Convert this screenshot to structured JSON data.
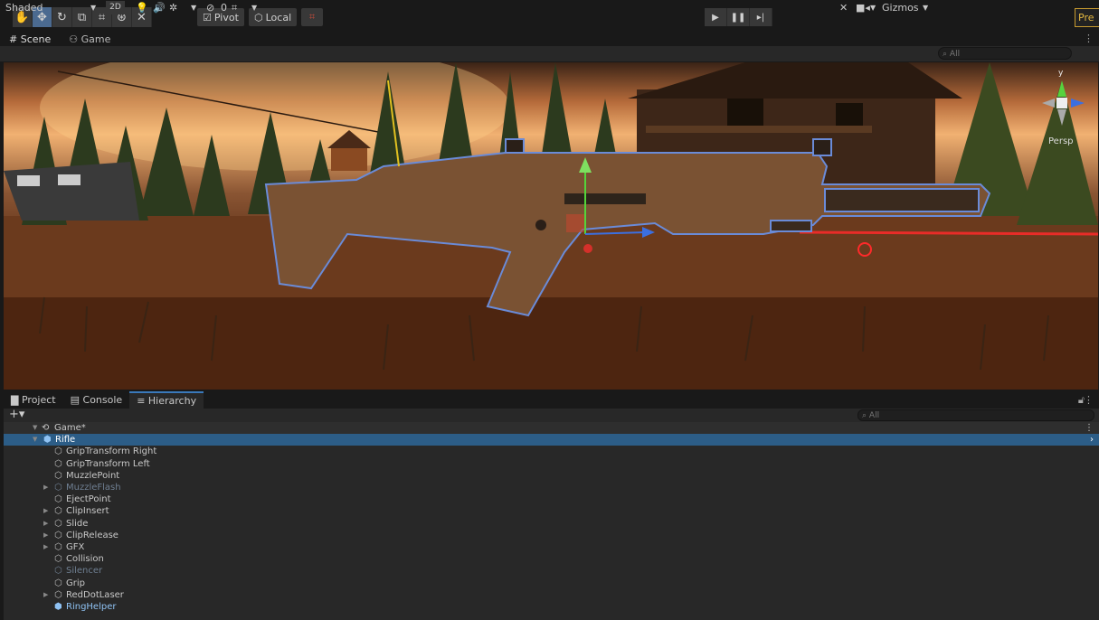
{
  "toolbar": {
    "tools": [
      "hand-tool",
      "move-tool",
      "rotate-tool",
      "scale-tool",
      "rect-tool",
      "transform-tool",
      "custom-tool"
    ],
    "pivot_label": "Pivot",
    "local_label": "Local",
    "preview_label": "Pre"
  },
  "scene_tabs": {
    "scene": "Scene",
    "game": "Game"
  },
  "scene_bar": {
    "shading": "Shaded",
    "mode_2d": "2D",
    "hidden_count": "0",
    "gizmos": "Gizmos",
    "search_placeholder": "All"
  },
  "viewport": {
    "orientation_label": "Persp",
    "gizmo_y": "y"
  },
  "bottom_tabs": {
    "project": "Project",
    "console": "Console",
    "hierarchy": "Hierarchy"
  },
  "hierarchy": {
    "search_placeholder": "All",
    "scene_name": "Game*",
    "rows": [
      {
        "label": "Rifle",
        "depth": 1,
        "expanded": true,
        "selected": true,
        "inactive": false,
        "prefab": true
      },
      {
        "label": "GripTransform Right",
        "depth": 2,
        "expanded": false,
        "hasChildren": false,
        "selected": false,
        "inactive": false
      },
      {
        "label": "GripTransform Left",
        "depth": 2,
        "hasChildren": false,
        "selected": false,
        "inactive": false
      },
      {
        "label": "MuzzlePoint",
        "depth": 2,
        "hasChildren": false,
        "selected": false,
        "inactive": false
      },
      {
        "label": "MuzzleFlash",
        "depth": 2,
        "hasChildren": true,
        "selected": false,
        "inactive": true
      },
      {
        "label": "EjectPoint",
        "depth": 2,
        "hasChildren": false,
        "selected": false,
        "inactive": false
      },
      {
        "label": "ClipInsert",
        "depth": 2,
        "hasChildren": true,
        "selected": false,
        "inactive": false
      },
      {
        "label": "Slide",
        "depth": 2,
        "hasChildren": true,
        "selected": false,
        "inactive": false
      },
      {
        "label": "ClipRelease",
        "depth": 2,
        "hasChildren": true,
        "selected": false,
        "inactive": false
      },
      {
        "label": "GFX",
        "depth": 2,
        "hasChildren": true,
        "selected": false,
        "inactive": false
      },
      {
        "label": "Collision",
        "depth": 2,
        "hasChildren": false,
        "selected": false,
        "inactive": false
      },
      {
        "label": "Silencer",
        "depth": 2,
        "hasChildren": false,
        "selected": false,
        "inactive": true
      },
      {
        "label": "Grip",
        "depth": 2,
        "hasChildren": false,
        "selected": false,
        "inactive": false
      },
      {
        "label": "RedDotLaser",
        "depth": 2,
        "hasChildren": true,
        "selected": false,
        "inactive": false
      },
      {
        "label": "RingHelper",
        "depth": 2,
        "hasChildren": false,
        "selected": false,
        "inactive": false,
        "prefab": true
      }
    ]
  },
  "colors": {
    "selection": "#2c5d87",
    "accent_blue": "#3a79bb",
    "preview_border": "#c69a2f"
  }
}
